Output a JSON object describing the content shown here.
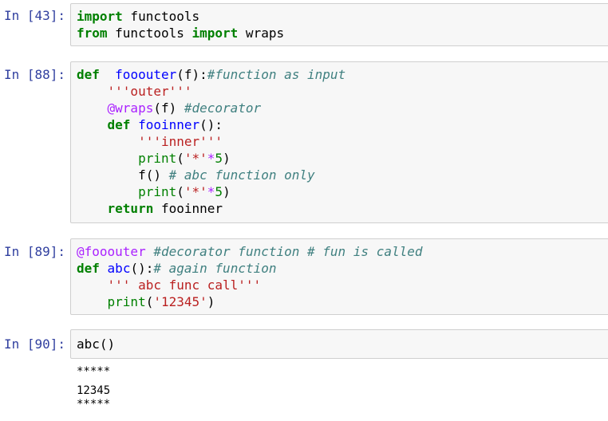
{
  "cells": [
    {
      "prompt": "In [43]:",
      "lines": [
        [
          {
            "t": "import",
            "c": "kw"
          },
          {
            "t": " functools",
            "c": ""
          }
        ],
        [
          {
            "t": "from",
            "c": "kw"
          },
          {
            "t": " functools ",
            "c": ""
          },
          {
            "t": "import",
            "c": "kw"
          },
          {
            "t": " wraps",
            "c": ""
          }
        ]
      ]
    },
    {
      "prompt": "In [88]:",
      "lines": [
        [
          {
            "t": "def",
            "c": "kw"
          },
          {
            "t": "  ",
            "c": ""
          },
          {
            "t": "fooouter",
            "c": "fn"
          },
          {
            "t": "(f):",
            "c": ""
          },
          {
            "t": "#function as input",
            "c": "cm"
          }
        ],
        [
          {
            "t": "    ",
            "c": ""
          },
          {
            "t": "'''outer'''",
            "c": "str"
          }
        ],
        [
          {
            "t": "    ",
            "c": ""
          },
          {
            "t": "@wraps",
            "c": "dec"
          },
          {
            "t": "(f) ",
            "c": ""
          },
          {
            "t": "#decorator",
            "c": "cm"
          }
        ],
        [
          {
            "t": "    ",
            "c": ""
          },
          {
            "t": "def",
            "c": "kw"
          },
          {
            "t": " ",
            "c": ""
          },
          {
            "t": "fooinner",
            "c": "fn"
          },
          {
            "t": "():",
            "c": ""
          }
        ],
        [
          {
            "t": "        ",
            "c": ""
          },
          {
            "t": "'''inner'''",
            "c": "str"
          }
        ],
        [
          {
            "t": "        ",
            "c": ""
          },
          {
            "t": "print",
            "c": "num"
          },
          {
            "t": "(",
            "c": ""
          },
          {
            "t": "'*'",
            "c": "str"
          },
          {
            "t": "*",
            "c": "op"
          },
          {
            "t": "5",
            "c": "num"
          },
          {
            "t": ")",
            "c": ""
          }
        ],
        [
          {
            "t": "        ",
            "c": ""
          },
          {
            "t": "f() ",
            "c": ""
          },
          {
            "t": "# abc function only",
            "c": "cm"
          }
        ],
        [
          {
            "t": "        ",
            "c": ""
          },
          {
            "t": "print",
            "c": "num"
          },
          {
            "t": "(",
            "c": ""
          },
          {
            "t": "'*'",
            "c": "str"
          },
          {
            "t": "*",
            "c": "op"
          },
          {
            "t": "5",
            "c": "num"
          },
          {
            "t": ")",
            "c": ""
          }
        ],
        [
          {
            "t": "    ",
            "c": ""
          },
          {
            "t": "return",
            "c": "kw"
          },
          {
            "t": " fooinner",
            "c": ""
          }
        ]
      ]
    },
    {
      "prompt": "In [89]:",
      "lines": [
        [
          {
            "t": "@fooouter",
            "c": "dec"
          },
          {
            "t": " ",
            "c": ""
          },
          {
            "t": "#decorator function # fun is called",
            "c": "cm"
          }
        ],
        [
          {
            "t": "def",
            "c": "kw"
          },
          {
            "t": " ",
            "c": ""
          },
          {
            "t": "abc",
            "c": "fn"
          },
          {
            "t": "():",
            "c": ""
          },
          {
            "t": "# again function",
            "c": "cm"
          }
        ],
        [
          {
            "t": "    ",
            "c": ""
          },
          {
            "t": "''' abc func call'''",
            "c": "str"
          }
        ],
        [
          {
            "t": "    ",
            "c": ""
          },
          {
            "t": "print",
            "c": "num"
          },
          {
            "t": "(",
            "c": ""
          },
          {
            "t": "'12345'",
            "c": "str"
          },
          {
            "t": ")",
            "c": ""
          }
        ]
      ]
    },
    {
      "prompt": "In [90]:",
      "lines": [
        [
          {
            "t": "abc()",
            "c": ""
          }
        ]
      ]
    }
  ],
  "output": [
    "*****",
    "12345",
    "*****"
  ],
  "colors": {
    "prompt": "#303f9f",
    "keyword": "#008000",
    "function_name": "#0000ff",
    "string": "#ba2121",
    "comment": "#408080",
    "decorator": "#aa22ff",
    "cell_background": "#f7f7f7",
    "cell_border": "#cfcfcf"
  }
}
